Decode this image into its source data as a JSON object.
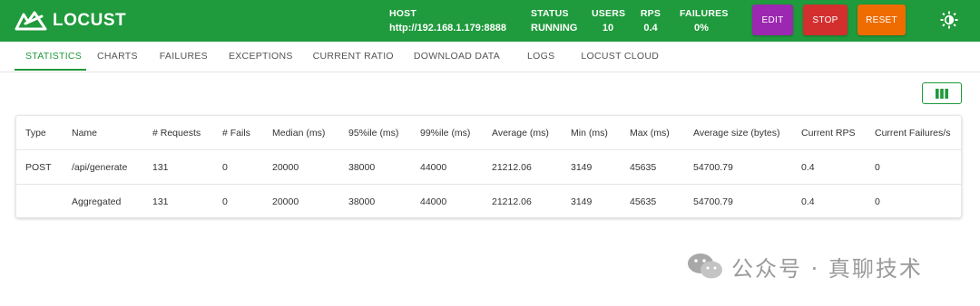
{
  "app": {
    "name": "LOCUST"
  },
  "header": {
    "host_label": "HOST",
    "host_value": "http://192.168.1.179:8888",
    "status_label": "STATUS",
    "status_value": "RUNNING",
    "users_label": "USERS",
    "users_value": "10",
    "rps_label": "RPS",
    "rps_value": "0.4",
    "failures_label": "FAILURES",
    "failures_value": "0%",
    "edit_label": "EDIT",
    "stop_label": "STOP",
    "reset_label": "RESET",
    "colors": {
      "bar": "#1f9a3c",
      "edit": "#9c27b0",
      "stop": "#d32f2f",
      "reset": "#ef6c00"
    }
  },
  "tabs": [
    {
      "label": "STATISTICS",
      "active": true
    },
    {
      "label": "CHARTS"
    },
    {
      "label": "FAILURES"
    },
    {
      "label": "EXCEPTIONS"
    },
    {
      "label": "CURRENT RATIO"
    },
    {
      "label": "DOWNLOAD DATA"
    },
    {
      "label": "LOGS"
    },
    {
      "label": "LOCUST CLOUD"
    }
  ],
  "table": {
    "columns": [
      "Type",
      "Name",
      "# Requests",
      "# Fails",
      "Median (ms)",
      "95%ile (ms)",
      "99%ile (ms)",
      "Average (ms)",
      "Min (ms)",
      "Max (ms)",
      "Average size (bytes)",
      "Current RPS",
      "Current Failures/s"
    ],
    "rows": [
      [
        "POST",
        "/api/generate",
        "131",
        "0",
        "20000",
        "38000",
        "44000",
        "21212.06",
        "3149",
        "45635",
        "54700.79",
        "0.4",
        "0"
      ],
      [
        "",
        "Aggregated",
        "131",
        "0",
        "20000",
        "38000",
        "44000",
        "21212.06",
        "3149",
        "45635",
        "54700.79",
        "0.4",
        "0"
      ]
    ]
  },
  "watermark": {
    "text": "公众号 · 真聊技术"
  }
}
